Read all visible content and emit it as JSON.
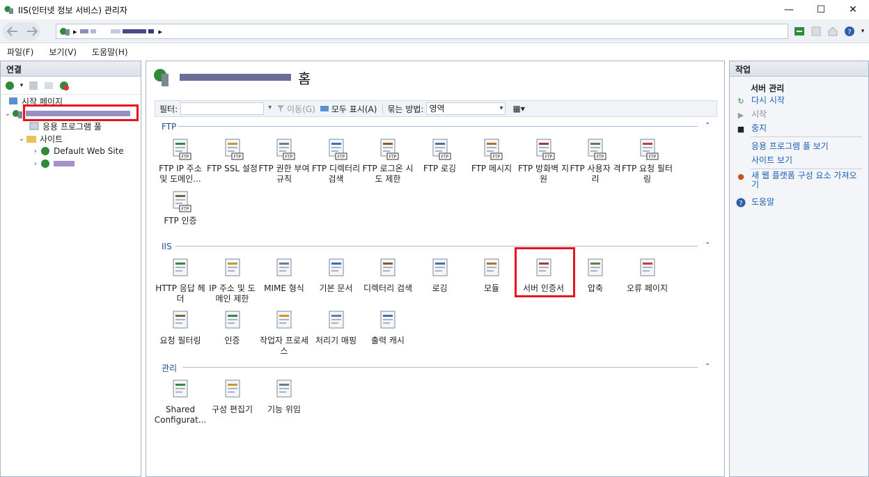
{
  "window": {
    "title": "IIS(인터넷 정보 서비스) 관리자",
    "minimize": "—",
    "maximize": "☐",
    "close": "✕"
  },
  "menu": [
    "파일(F)",
    "보기(V)",
    "도움말(H)"
  ],
  "connections": {
    "header": "연결",
    "tree": {
      "start_page": "시작 페이지",
      "app_pools": "응용 프로그램 풀",
      "sites": "사이트",
      "default_site": "Default Web Site"
    }
  },
  "center": {
    "title_suffix": "홈",
    "filter": {
      "label": "필터:",
      "go": "이동(G)",
      "show_all": "모두 표시(A)",
      "group_label": "묶는 방법:",
      "group_value": "영역"
    },
    "sections": {
      "ftp": {
        "title": "FTP",
        "items": [
          "FTP IP 주소 및 도메인...",
          "FTP SSL 설정",
          "FTP 권한 부여 규칙",
          "FTP 디렉터리 검색",
          "FTP 로그온 시도 제한",
          "FTP 로깅",
          "FTP 메시지",
          "FTP 방화벽 지원",
          "FTP 사용자 격리",
          "FTP 요청 필터링",
          "FTP 인증"
        ]
      },
      "iis": {
        "title": "IIS",
        "items": [
          "HTTP 응답 헤더",
          "IP 주소 및 도메인 제한",
          "MIME 형식",
          "기본 문서",
          "디렉터리 검색",
          "로깅",
          "모듈",
          "서버 인증서",
          "압축",
          "오류 페이지",
          "요청 필터링",
          "인증",
          "작업자 프로세스",
          "처리기 매핑",
          "출력 캐시"
        ]
      },
      "mgmt": {
        "title": "관리",
        "items": [
          "Shared Configurat...",
          "구성 편집기",
          "기능 위임"
        ]
      }
    }
  },
  "actions": {
    "header": "작업",
    "server_title": "서버 관리",
    "restart": "다시 시작",
    "start": "시작",
    "stop": "중지",
    "view_pools": "응용 프로그램 풀 보기",
    "view_sites": "사이트 보기",
    "get_components": "새 웹 플랫폼 구성 요소 가져오기",
    "help": "도움말"
  },
  "colors": {
    "accent": "#1c5fb3",
    "highlight": "#e5141d"
  }
}
